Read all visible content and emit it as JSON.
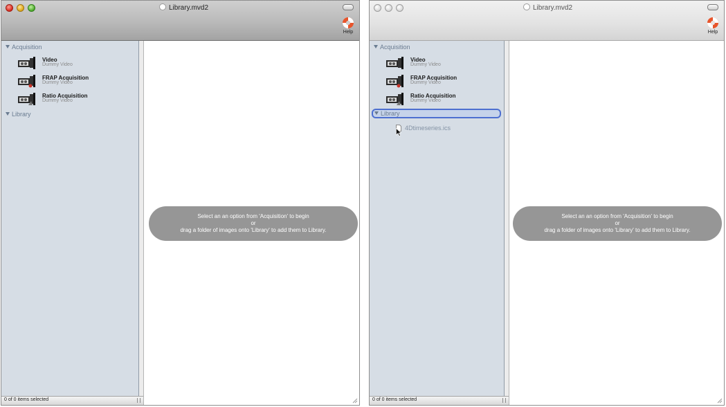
{
  "windows": [
    {
      "state": "active",
      "title": "Library.mvd2",
      "toolbar": {
        "help_label": "Help"
      },
      "sidebar": {
        "acquisition_header": "Acquisition",
        "items": [
          {
            "title": "Video",
            "subtitle": "Dummy Video",
            "icon": "video-camera-icon"
          },
          {
            "title": "FRAP Acquisition",
            "subtitle": "Dummy Video",
            "icon": "frap-camera-icon"
          },
          {
            "title": "Ratio Acquisition",
            "subtitle": "Dummy Video",
            "icon": "ratio-camera-icon"
          }
        ],
        "library_header": "Library",
        "library_items": []
      },
      "status": "0 of 0 items selected",
      "hint": {
        "line1": "Select an an option from 'Acquisition' to begin",
        "line2": "or",
        "line3": "drag a folder of images onto 'Library' to add them to Library."
      }
    },
    {
      "state": "inactive",
      "title": "Library.mvd2",
      "toolbar": {
        "help_label": "Help"
      },
      "sidebar": {
        "acquisition_header": "Acquisition",
        "items": [
          {
            "title": "Video",
            "subtitle": "Dummy Video",
            "icon": "video-camera-icon"
          },
          {
            "title": "FRAP Acquisition",
            "subtitle": "Dummy Video",
            "icon": "frap-camera-icon"
          },
          {
            "title": "Ratio Acquisition",
            "subtitle": "Dummy Video",
            "icon": "ratio-camera-icon"
          }
        ],
        "library_header": "Library",
        "library_items": [
          {
            "label": "4Dtimeseries.ics",
            "icon": "file-icon"
          }
        ]
      },
      "status": "0 of 0 items selected",
      "hint": {
        "line1": "Select an an option from 'Acquisition' to begin",
        "line2": "or",
        "line3": "drag a folder of images onto 'Library' to add them to Library."
      }
    }
  ],
  "colors": {
    "sidebar_bg": "#d6dde5",
    "group_header_text": "#6a7c91",
    "selection_border": "#4d6fd0",
    "hint_bg": "#969696",
    "close_red": "#d8281c",
    "minimize_yellow": "#dca514",
    "zoom_green": "#4ba92a"
  }
}
